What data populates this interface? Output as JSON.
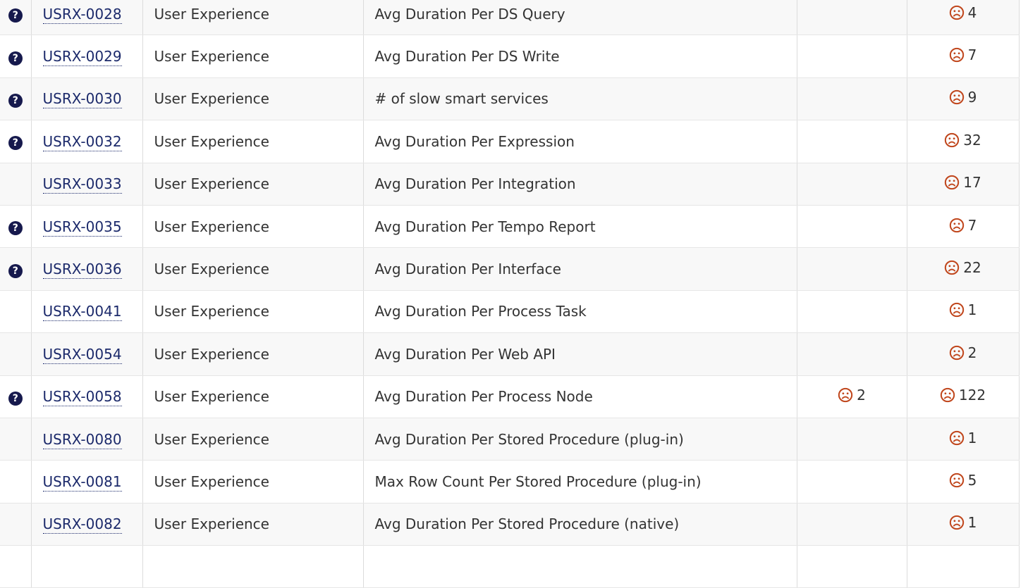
{
  "colors": {
    "help_icon": "#16194d",
    "link": "#1c2a6b",
    "frown_icon": "#c0461c",
    "row_alt": "#f8f8f8"
  },
  "rows": [
    {
      "help": true,
      "id": "USRX-0028",
      "category": "User Experience",
      "name": "Avg Duration Per DS Query",
      "count1": "",
      "count2": "4"
    },
    {
      "help": true,
      "id": "USRX-0029",
      "category": "User Experience",
      "name": "Avg Duration Per DS Write",
      "count1": "",
      "count2": "7"
    },
    {
      "help": true,
      "id": "USRX-0030",
      "category": "User Experience",
      "name": "# of slow smart services",
      "count1": "",
      "count2": "9"
    },
    {
      "help": true,
      "id": "USRX-0032",
      "category": "User Experience",
      "name": "Avg Duration Per Expression",
      "count1": "",
      "count2": "32"
    },
    {
      "help": false,
      "id": "USRX-0033",
      "category": "User Experience",
      "name": "Avg Duration Per Integration",
      "count1": "",
      "count2": "17"
    },
    {
      "help": true,
      "id": "USRX-0035",
      "category": "User Experience",
      "name": "Avg Duration Per Tempo Report",
      "count1": "",
      "count2": "7"
    },
    {
      "help": true,
      "id": "USRX-0036",
      "category": "User Experience",
      "name": "Avg Duration Per Interface",
      "count1": "",
      "count2": "22"
    },
    {
      "help": false,
      "id": "USRX-0041",
      "category": "User Experience",
      "name": "Avg Duration Per Process Task",
      "count1": "",
      "count2": "1"
    },
    {
      "help": false,
      "id": "USRX-0054",
      "category": "User Experience",
      "name": "Avg Duration Per Web API",
      "count1": "",
      "count2": "2"
    },
    {
      "help": true,
      "id": "USRX-0058",
      "category": "User Experience",
      "name": "Avg Duration Per Process Node",
      "count1": "2",
      "count2": "122"
    },
    {
      "help": false,
      "id": "USRX-0080",
      "category": "User Experience",
      "name": "Avg Duration Per Stored Procedure (plug-in)",
      "count1": "",
      "count2": "1"
    },
    {
      "help": false,
      "id": "USRX-0081",
      "category": "User Experience",
      "name": "Max Row Count Per Stored Procedure (plug-in)",
      "count1": "",
      "count2": "5"
    },
    {
      "help": false,
      "id": "USRX-0082",
      "category": "User Experience",
      "name": "Avg Duration Per Stored Procedure (native)",
      "count1": "",
      "count2": "1"
    },
    {
      "help": false,
      "id": "",
      "category": "",
      "name": "",
      "count1": "",
      "count2": ""
    }
  ]
}
